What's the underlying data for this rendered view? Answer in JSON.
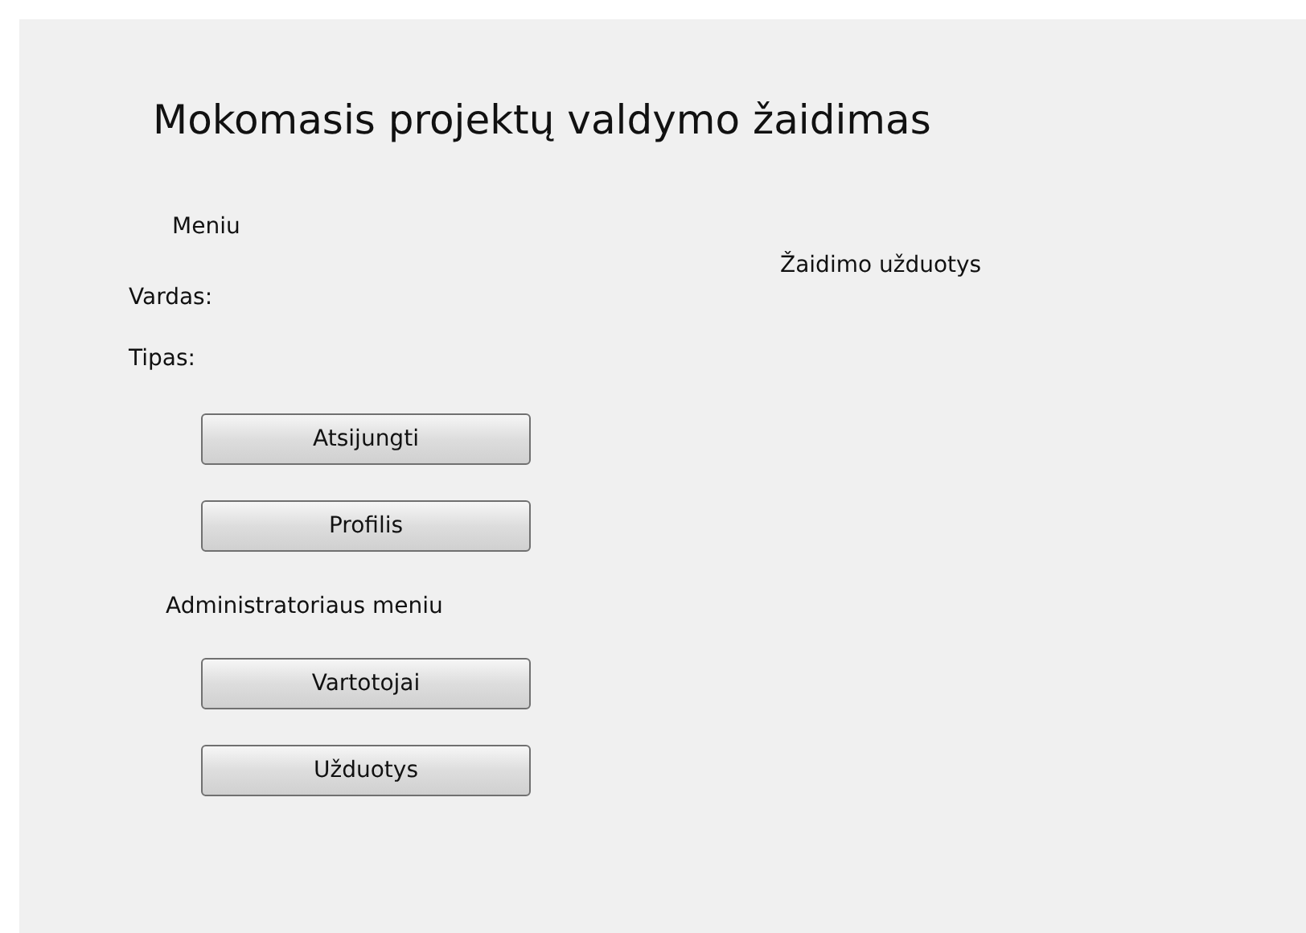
{
  "window": {
    "title": "Mokomasis projektų valdymo žaidimas"
  },
  "menu": {
    "heading": "Meniu",
    "fields": [
      "Vardas:",
      "Tipas:"
    ],
    "buttons": [
      "Atsijungti",
      "Profilis"
    ]
  },
  "admin_menu": {
    "heading": "Administratoriaus meniu",
    "buttons": [
      "Vartotojai",
      "Užduotys"
    ]
  },
  "tasks": {
    "heading": "Žaidimo užduotys"
  }
}
